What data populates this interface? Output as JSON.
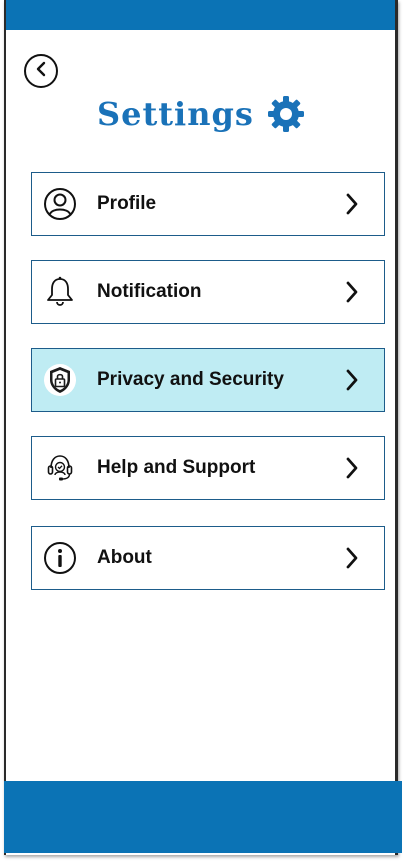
{
  "header": {
    "title": "Settings",
    "back_icon": "chevron-left-icon",
    "title_icon": "gear-icon"
  },
  "menu": {
    "items": [
      {
        "label": "Profile",
        "icon": "user-icon"
      },
      {
        "label": "Notification",
        "icon": "bell-icon"
      },
      {
        "label": "Privacy and Security",
        "icon": "shield-lock-icon",
        "selected": true
      },
      {
        "label": "Help and Support",
        "icon": "headset-icon"
      },
      {
        "label": "About",
        "icon": "info-icon"
      }
    ]
  },
  "colors": {
    "brand_blue": "#0b73b5",
    "title_blue": "#1a72b8",
    "selected_bg": "#bfecf3",
    "item_border": "#1d5c8a"
  }
}
